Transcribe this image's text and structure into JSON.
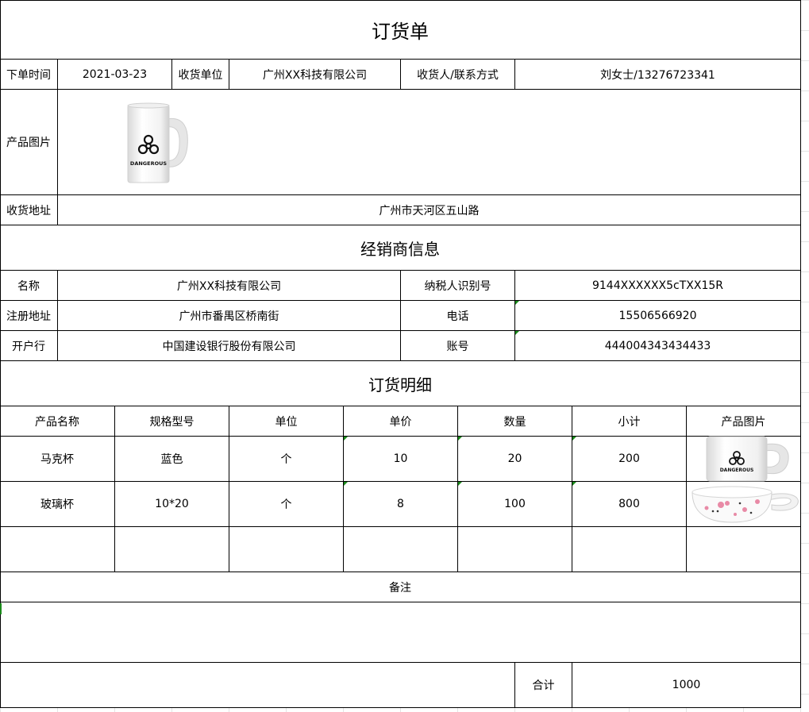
{
  "title": "订货单",
  "order": {
    "date_label": "下单时间",
    "date": "2021-03-23",
    "recipient_unit_label": "收货单位",
    "recipient_unit": "广州XX科技有限公司",
    "contact_label": "收货人/联系方式",
    "contact": "刘女士/13276723341",
    "image_label": "产品图片",
    "address_label": "收货地址",
    "address": "广州市天河区五山路"
  },
  "dealer": {
    "heading": "经销商信息",
    "name_label": "名称",
    "name": "广州XX科技有限公司",
    "tax_label": "纳税人识别号",
    "tax_id": "9144XXXXXX5cTXX15R",
    "reg_address_label": "注册地址",
    "reg_address": "广州市番禺区桥南街",
    "phone_label": "电话",
    "phone": "15506566920",
    "bank_label": "开户行",
    "bank": "中国建设银行股份有限公司",
    "account_label": "账号",
    "account": "444004343434433"
  },
  "details": {
    "heading": "订货明细",
    "columns": [
      "产品名称",
      "规格型号",
      "单位",
      "单价",
      "数量",
      "小计",
      "产品图片"
    ],
    "rows": [
      {
        "name": "马克杯",
        "spec": "蓝色",
        "unit": "个",
        "price": "10",
        "qty": "20",
        "subtotal": "200"
      },
      {
        "name": "玻璃杯",
        "spec": "10*20",
        "unit": "个",
        "price": "8",
        "qty": "100",
        "subtotal": "800"
      }
    ]
  },
  "remarks": {
    "label": "备注"
  },
  "total": {
    "label": "合计",
    "value": "1000"
  },
  "mug_print": "DANGEROUS",
  "colors": {
    "border": "#000000",
    "marker": "#1a8a1a",
    "cup_pink": "#e88aa6"
  }
}
